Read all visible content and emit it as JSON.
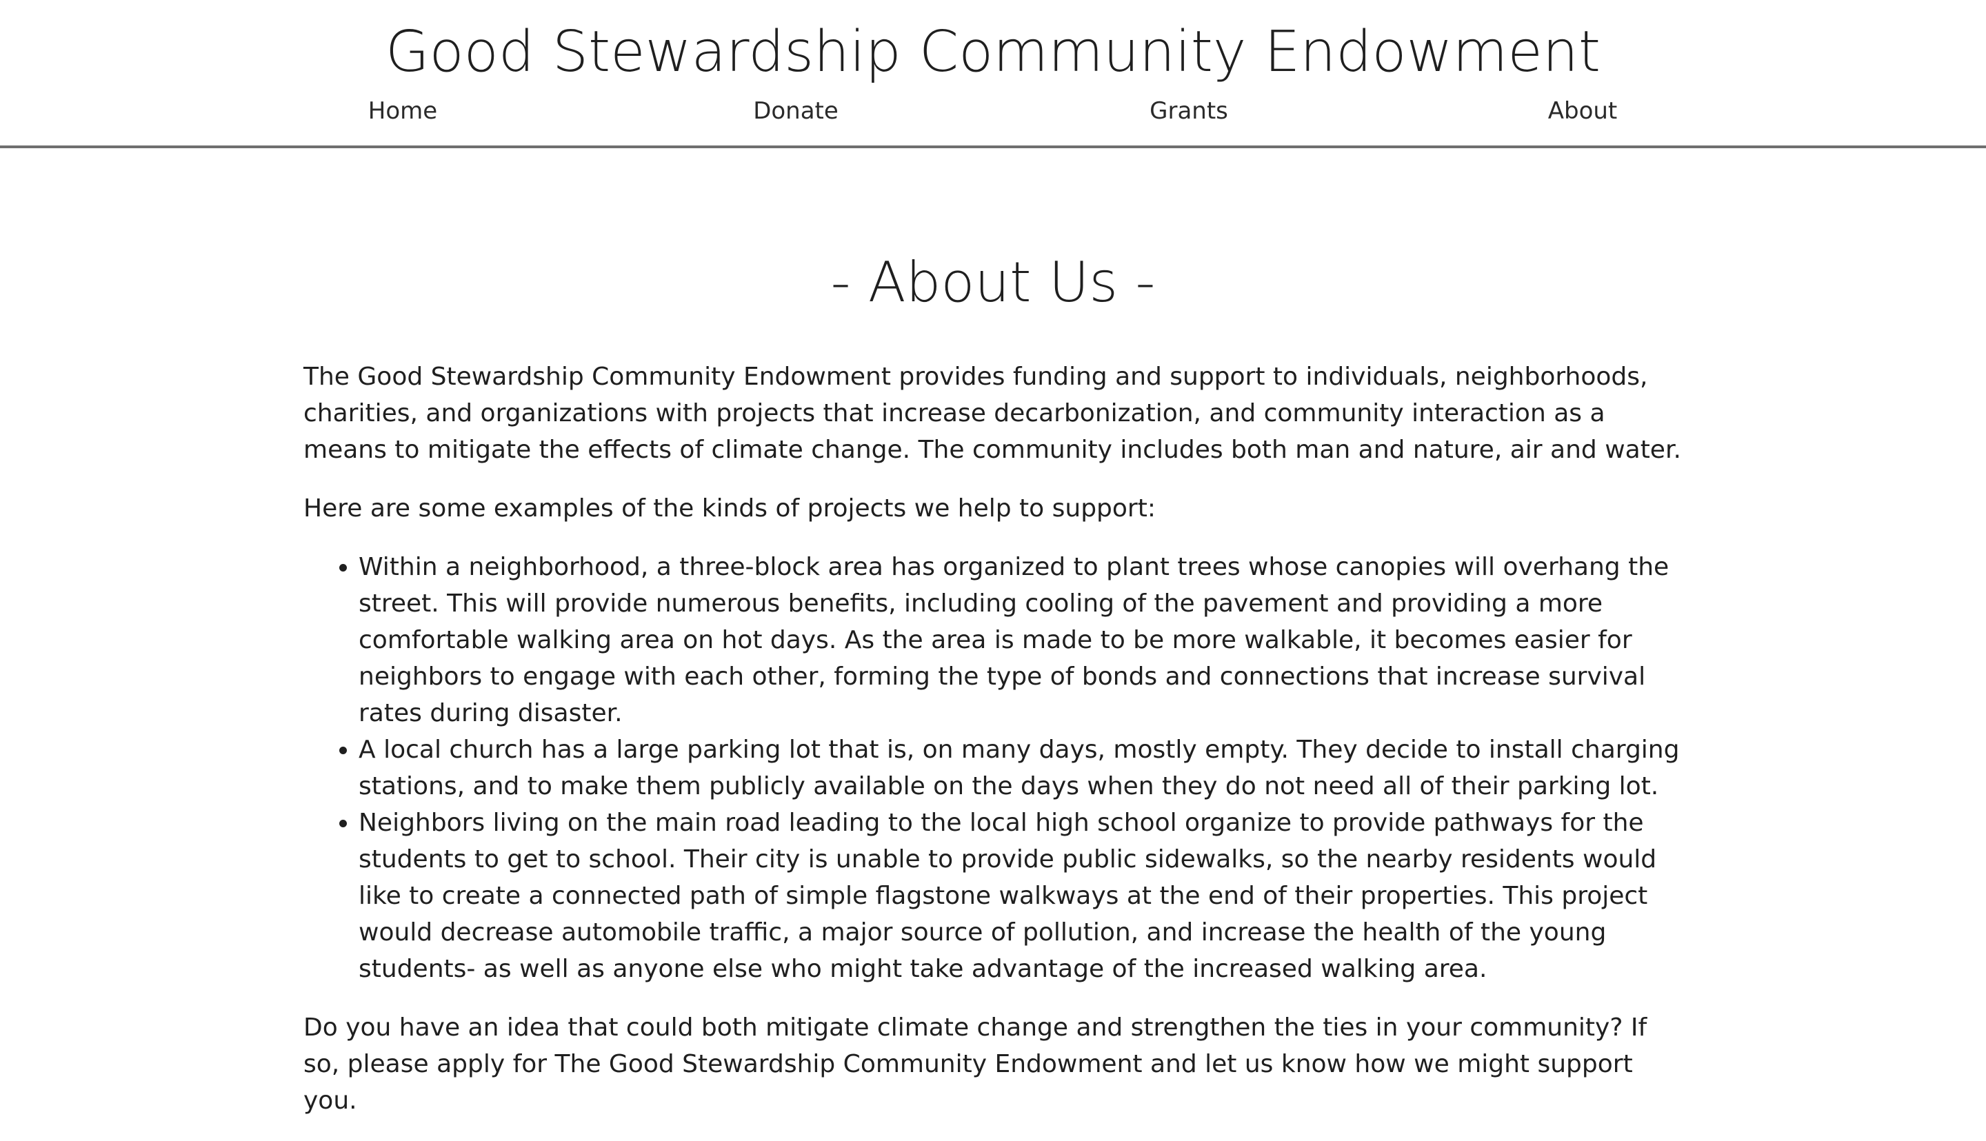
{
  "header": {
    "title": "Good Stewardship Community Endowment",
    "nav": [
      {
        "label": "Home"
      },
      {
        "label": "Donate"
      },
      {
        "label": "Grants"
      },
      {
        "label": "About"
      }
    ]
  },
  "main": {
    "heading": "- About Us -",
    "intro": "The Good Stewardship Community Endowment provides funding and support to individuals, neighborhoods, charities, and organizations with projects that increase decarbonization, and community interaction as a means to mitigate the effects of climate change. The community includes both man and nature, air and water.",
    "examples_intro": "Here are some examples of the kinds of projects we help to support:",
    "examples": [
      "Within a neighborhood, a three-block area has organized to plant trees whose canopies will overhang the street. This will provide numerous benefits, including cooling of the pavement and providing a more comfortable walking area on hot days. As the area is made to be more walkable, it becomes easier for neighbors to engage with each other, forming the type of bonds and connections that increase survival rates during disaster.",
      "A local church has a large parking lot that is, on many days, mostly empty. They decide to install charging stations, and to make them publicly available on the days when they do not need all of their parking lot.",
      "Neighbors living on the main road leading to the local high school organize to provide pathways for the students to get to school. Their city is unable to provide public sidewalks, so the nearby residents would like to create a connected path of simple flagstone walkways at the end of their properties. This project would decrease automobile traffic, a major source of pollution, and increase the health of the young students- as well as anyone else who might take advantage of the increased walking area."
    ],
    "closing": "Do you have an idea that could both mitigate climate change and strengthen the ties in your community? If so, please apply for The Good Stewardship Community Endowment and let us know how we might support you."
  }
}
